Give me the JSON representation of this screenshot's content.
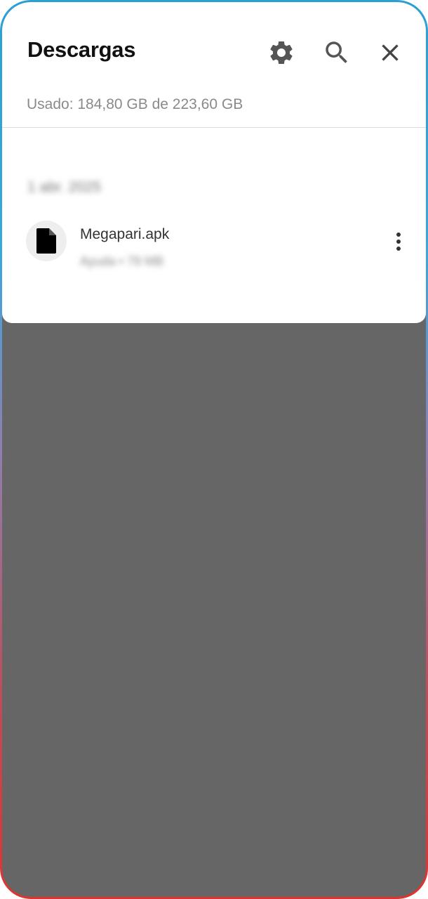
{
  "header": {
    "title": "Descargas",
    "icons": [
      "gear-icon",
      "search-icon",
      "close-icon"
    ]
  },
  "storage": {
    "usage_text": "Usado: 184,80 GB de 223,60 GB"
  },
  "downloads": {
    "date_label": "1 abr. 2025",
    "items": [
      {
        "name": "Megapari.apk",
        "meta": "Ayuda • 79 MB",
        "icon": "file-icon"
      }
    ]
  },
  "colors": {
    "overlay": "#666666",
    "sheet": "#ffffff",
    "border_top": "#2a9fd6",
    "border_bottom": "#e0332f"
  }
}
